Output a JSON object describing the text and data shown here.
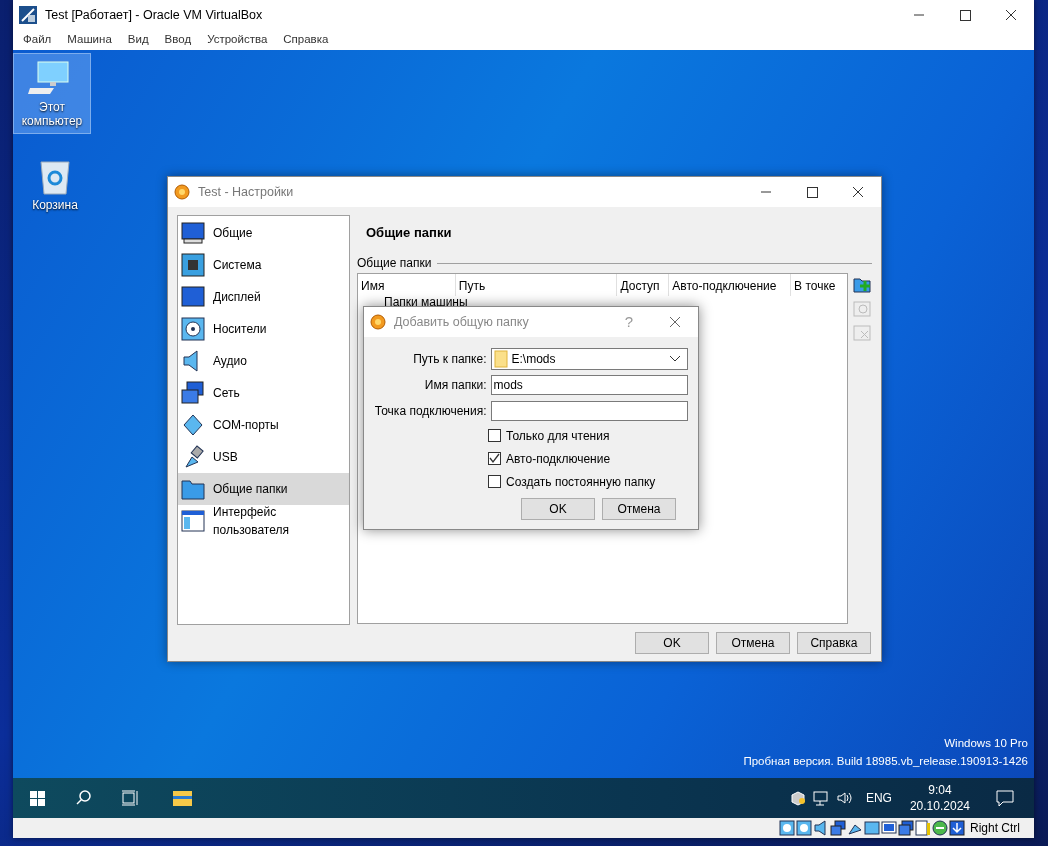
{
  "window": {
    "title": "Test [Работает] - Oracle VM VirtualBox",
    "menu": [
      "Файл",
      "Машина",
      "Вид",
      "Ввод",
      "Устройства",
      "Справка"
    ]
  },
  "desktop": {
    "icons": [
      {
        "label": "Этот компьютер",
        "selected": true
      },
      {
        "label": "Корзина",
        "selected": false
      }
    ],
    "watermark_lines": [
      "Windows 10 Pro",
      "Пробная версия. Build 18985.vb_release.190913-1426"
    ]
  },
  "settings": {
    "title": "Test - Настройки",
    "sidebar": [
      {
        "label": "Общие",
        "selected": false
      },
      {
        "label": "Система",
        "selected": false
      },
      {
        "label": "Дисплей",
        "selected": false
      },
      {
        "label": "Носители",
        "selected": false
      },
      {
        "label": "Аудио",
        "selected": false
      },
      {
        "label": "Сеть",
        "selected": false
      },
      {
        "label": "COM-порты",
        "selected": false
      },
      {
        "label": "USB",
        "selected": false
      },
      {
        "label": "Общие папки",
        "selected": true
      },
      {
        "label": "Интерфейс пользователя",
        "selected": false
      }
    ],
    "heading": "Общие папки",
    "group_label": "Общие папки",
    "table": {
      "columns": [
        "Имя",
        "Путь",
        "Доступ",
        "Авто-подключение",
        "В точке"
      ],
      "rows": [
        "Папки машины"
      ]
    },
    "buttons": [
      "OK",
      "Отмена",
      "Справка"
    ]
  },
  "add_dialog": {
    "title": "Добавить общую папку",
    "help": "?",
    "fields": [
      {
        "kind": "combo",
        "label": "Путь к папке:",
        "value": "E:\\mods"
      },
      {
        "kind": "text",
        "label": "Имя папки:",
        "value": "mods"
      },
      {
        "kind": "text",
        "label": "Точка подключения:"
      }
    ],
    "options": [
      {
        "label": "Только для чтения",
        "checked": false
      },
      {
        "label": "Авто-подключение",
        "checked": true
      },
      {
        "label": "Создать постоянную папку",
        "checked": false
      }
    ],
    "buttons": [
      "OK",
      "Отмена"
    ]
  },
  "taskbar": {
    "language": "ENG",
    "time": "9:04",
    "date": "20.10.2024"
  },
  "status_bar": {
    "host_key": "Right Ctrl"
  }
}
